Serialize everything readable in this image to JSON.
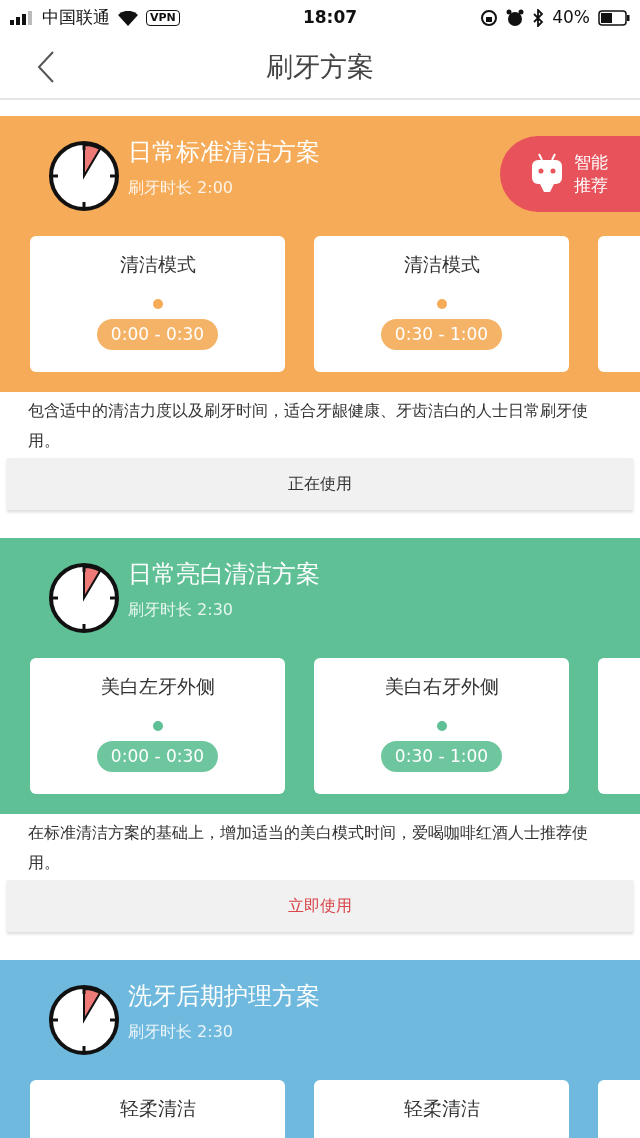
{
  "status_bar": {
    "carrier": "中国联通",
    "vpn": "VPN",
    "time": "18:07",
    "battery": "40%"
  },
  "nav": {
    "title": "刷牙方案"
  },
  "plans": [
    {
      "title": "日常标准清洁方案",
      "duration": "刷牙时长 2:00",
      "color": "#f5ab57",
      "badge": "智能推荐",
      "segments": [
        {
          "label": "清洁模式",
          "time": "0:00 - 0:30"
        },
        {
          "label": "清洁模式",
          "time": "0:30 - 1:00"
        }
      ],
      "more_cards": true,
      "description": "包含适中的清洁力度以及刷牙时间，适合牙龈健康、牙齿洁白的人士日常刷牙使用。",
      "action": "正在使用",
      "in_use": true
    },
    {
      "title": "日常亮白清洁方案",
      "duration": "刷牙时长 2:30",
      "color": "#5ec094",
      "segments": [
        {
          "label": "美白左牙外侧",
          "time": "0:00 - 0:30"
        },
        {
          "label": "美白右牙外侧",
          "time": "0:30 - 1:00"
        }
      ],
      "more_cards": true,
      "description": "在标准清洁方案的基础上，增加适当的美白模式时间，爱喝咖啡红酒人士推荐使用。",
      "action": "立即使用",
      "in_use": false
    },
    {
      "title": "洗牙后期护理方案",
      "duration": "刷牙时长 2:30",
      "color": "#6fb9de",
      "segments": [
        {
          "label": "轻柔清洁"
        },
        {
          "label": "轻柔清洁"
        }
      ],
      "more_cards": true
    }
  ]
}
